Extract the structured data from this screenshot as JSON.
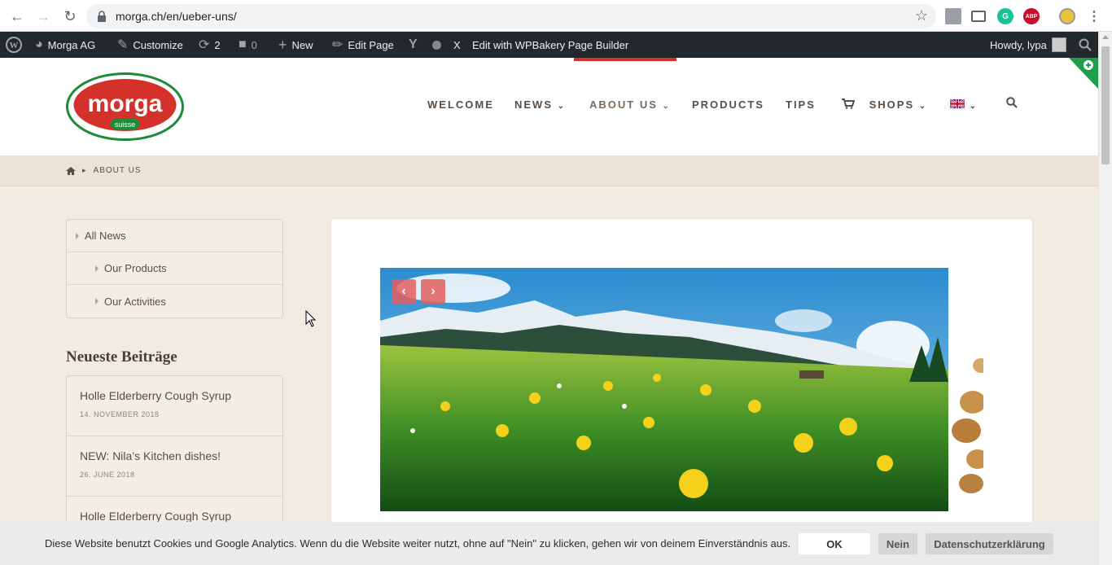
{
  "browser": {
    "url": "morga.ch/en/ueber-uns/"
  },
  "adminbar": {
    "site": "Morga AG",
    "customize": "Customize",
    "updates": "2",
    "comments": "0",
    "new": "New",
    "edit_page": "Edit Page",
    "x_label": "X",
    "builder": "Edit with WPBakery Page Builder",
    "howdy": "Howdy, lypa"
  },
  "logo": {
    "word": "morga",
    "sub": "suisse"
  },
  "nav": {
    "items": [
      {
        "label": "WELCOME"
      },
      {
        "label": "NEWS"
      },
      {
        "label": "ABOUT US"
      },
      {
        "label": "PRODUCTS"
      },
      {
        "label": "TIPS"
      },
      {
        "label": "SHOPS"
      }
    ]
  },
  "breadcrumb": {
    "current": "ABOUT US"
  },
  "sidebar": {
    "menu": [
      {
        "label": "All News"
      },
      {
        "label": "Our Products"
      },
      {
        "label": "Our Activities"
      }
    ],
    "recent_title": "Neueste Beiträge",
    "posts": [
      {
        "title": "Holle Elderberry Cough Syrup",
        "date": "14. NOVEMBER 2018"
      },
      {
        "title": "NEW: Nila’s Kitchen dishes!",
        "date": "26. JUNE 2018"
      },
      {
        "title": "Holle Elderberry Cough Syrup",
        "date": ""
      }
    ]
  },
  "cookie": {
    "message": "Diese Website benutzt Cookies und Google Analytics. Wenn du die Website weiter nutzt, ohne auf \"Nein\" zu klicken, gehen wir von deinem Einverständnis aus.",
    "ok": "OK",
    "no": "Nein",
    "privacy": "Datenschutzerklärung"
  },
  "colors": {
    "accent_red": "#d5312b",
    "admin_bar": "#23282d",
    "nav_text": "#5a4e44"
  }
}
